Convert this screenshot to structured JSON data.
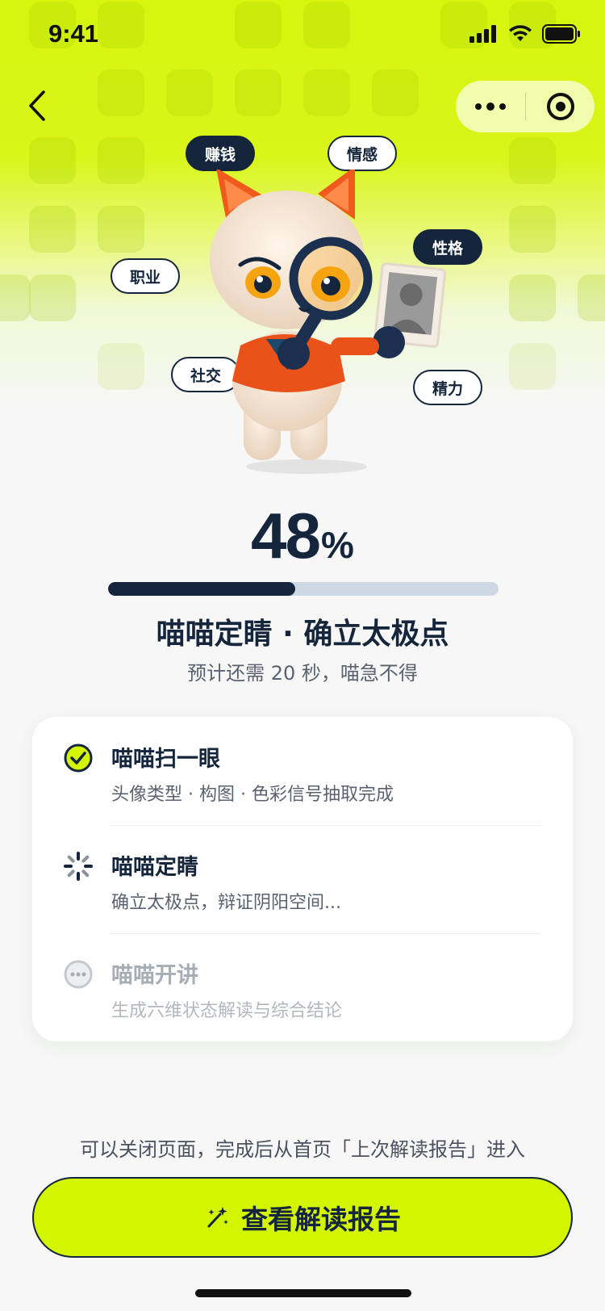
{
  "status_bar": {
    "time": "9:41"
  },
  "tags": {
    "earn": "赚钱",
    "emotion": "情感",
    "personality": "性格",
    "career": "职业",
    "social": "社交",
    "energy": "精力"
  },
  "progress": {
    "value": "48",
    "unit": "%",
    "fraction": 0.48,
    "stage_title": "喵喵定睛 · 确立太极点",
    "eta": "预计还需 20 秒，喵急不得"
  },
  "steps": [
    {
      "title": "喵喵扫一眼",
      "desc": "头像类型 · 构图 · 色彩信号抽取完成",
      "state": "done",
      "icon": "check-circle-icon"
    },
    {
      "title": "喵喵定睛",
      "desc": "确立太极点，辩证阴阳空间...",
      "state": "active",
      "icon": "spinner-icon"
    },
    {
      "title": "喵喵开讲",
      "desc": "生成六维状态解读与综合结论",
      "state": "pending",
      "icon": "ellipsis-circle-icon"
    }
  ],
  "hint": "可以关闭页面，完成后从首页「上次解读报告」进入",
  "cta": {
    "label": "查看解读报告",
    "icon": "magic-wand-icon"
  },
  "colors": {
    "accent": "#d4f500",
    "navy": "#15253b",
    "track": "#ced8e2"
  }
}
